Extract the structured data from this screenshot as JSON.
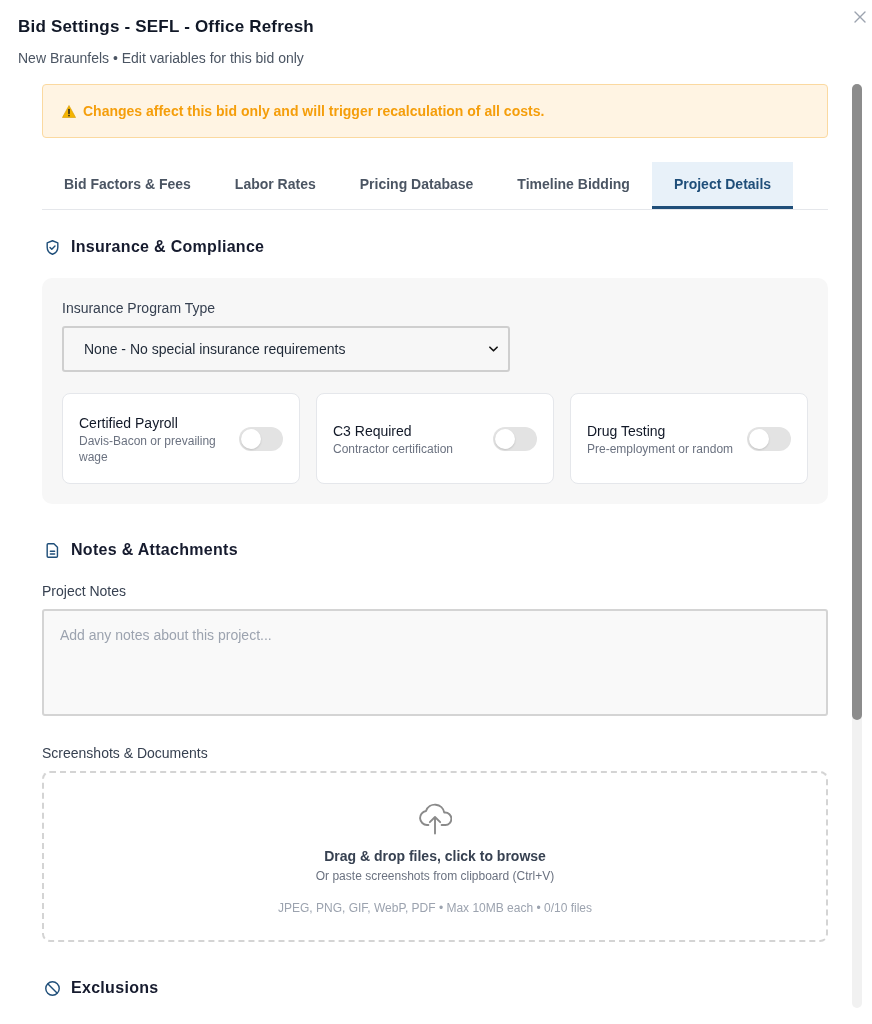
{
  "dialog": {
    "title": "Bid Settings - SEFL - Office Refresh",
    "subtitle": "New Braunfels • Edit variables for this bid only"
  },
  "alert": {
    "text": "Changes affect this bid only and will trigger recalculation of all costs."
  },
  "tabs": [
    {
      "label": "Bid Factors & Fees",
      "selected": false
    },
    {
      "label": "Labor Rates",
      "selected": false
    },
    {
      "label": "Pricing Database",
      "selected": false
    },
    {
      "label": "Timeline Bidding",
      "selected": false
    },
    {
      "label": "Project Details",
      "selected": true
    }
  ],
  "insurance": {
    "heading": "Insurance & Compliance",
    "program_type": {
      "label": "Insurance Program Type",
      "value": "None - No special insurance requirements"
    },
    "toggles": [
      {
        "title": "Certified Payroll",
        "description": "Davis-Bacon or prevailing wage",
        "on": false
      },
      {
        "title": "C3 Required",
        "description": "Contractor certification",
        "on": false
      },
      {
        "title": "Drug Testing",
        "description": "Pre-employment or random",
        "on": false
      }
    ]
  },
  "notes": {
    "heading": "Notes & Attachments",
    "project_notes": {
      "label": "Project Notes",
      "placeholder": "Add any notes about this project..."
    },
    "attachments": {
      "label": "Screenshots & Documents",
      "prompt": "Drag & drop files, click to browse",
      "hint": "Or paste screenshots from clipboard (Ctrl+V)",
      "limits": "JPEG, PNG, GIF, WebP, PDF • Max 10MB each • 0/10 files"
    }
  },
  "exclusions": {
    "heading": "Exclusions"
  }
}
